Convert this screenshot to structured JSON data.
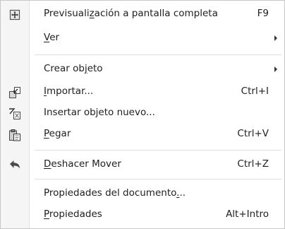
{
  "items": [
    {
      "id": "preview",
      "pre": "Previsuali",
      "u": "z",
      "post": "ación a pantalla completa",
      "shortcut": "F9",
      "icon": "fullscreen-preview-icon"
    },
    {
      "id": "view",
      "pre": "",
      "u": "V",
      "post": "er",
      "shortcut": "",
      "submenu": true
    },
    {
      "id": "create",
      "pre": "Crear ob",
      "u": "j",
      "post": "eto",
      "shortcut": "",
      "submenu": true
    },
    {
      "id": "import",
      "pre": "",
      "u": "I",
      "post": "mportar...",
      "shortcut": "Ctrl+I",
      "icon": "import-icon"
    },
    {
      "id": "insert",
      "pre": "Insertar objeto nuevo...",
      "u": "",
      "post": "",
      "shortcut": "",
      "icon": "insert-object-icon"
    },
    {
      "id": "paste",
      "pre": "",
      "u": "P",
      "post": "egar",
      "shortcut": "Ctrl+V",
      "icon": "paste-icon"
    },
    {
      "id": "undo",
      "pre": "",
      "u": "D",
      "post": "eshacer Mover",
      "shortcut": "Ctrl+Z",
      "icon": "undo-icon"
    },
    {
      "id": "docprops",
      "pre": "Propiedades del documento",
      "u": ".",
      "post": "..",
      "shortcut": ""
    },
    {
      "id": "props",
      "pre": "",
      "u": "P",
      "post": "ropiedades",
      "shortcut": "Alt+Intro"
    }
  ]
}
